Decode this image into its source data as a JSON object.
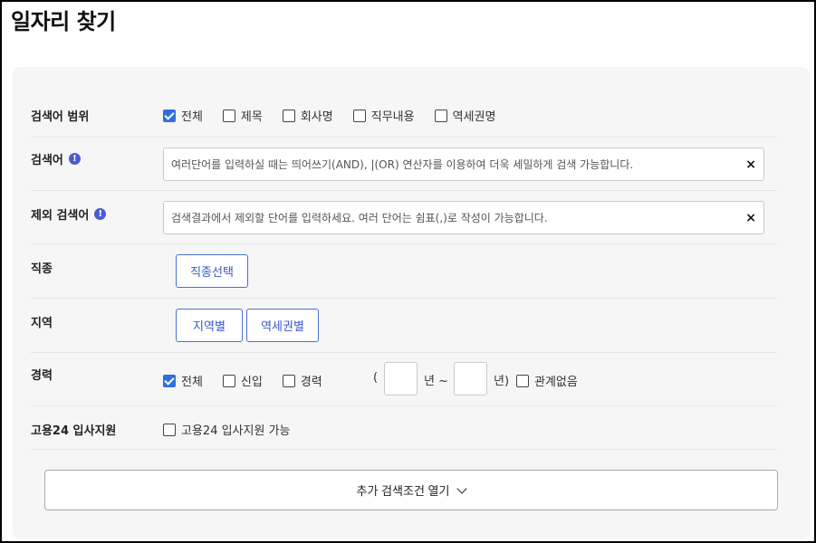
{
  "page": {
    "title": "일자리 찾기"
  },
  "search_scope": {
    "label": "검색어 범위",
    "options": [
      {
        "label": "전체",
        "checked": true
      },
      {
        "label": "제목",
        "checked": false
      },
      {
        "label": "회사명",
        "checked": false
      },
      {
        "label": "직무내용",
        "checked": false
      },
      {
        "label": "역세권명",
        "checked": false
      }
    ]
  },
  "keyword": {
    "label": "검색어",
    "info_icon": "!",
    "placeholder": "여러단어를 입력하실 때는 띄어쓰기(AND), |(OR) 연산자를 이용하여 더욱 세밀하게 검색 가능합니다.",
    "clear_icon": "×"
  },
  "exclude_keyword": {
    "label": "제외 검색어",
    "info_icon": "!",
    "placeholder": "검색결과에서 제외할 단어를 입력하세요. 여러 단어는 쉼표(,)로 작성이 가능합니다.",
    "clear_icon": "×"
  },
  "job_type": {
    "label": "직종",
    "button": "직종선택"
  },
  "region": {
    "label": "지역",
    "buttons": [
      "지역별",
      "역세권별"
    ]
  },
  "career": {
    "label": "경력",
    "options": [
      {
        "label": "전체",
        "checked": true
      },
      {
        "label": "신입",
        "checked": false
      },
      {
        "label": "경력",
        "checked": false
      }
    ],
    "open_paren": "(",
    "year_label_1": "년 ~",
    "year_label_2": "년)",
    "no_matter": {
      "label": "관계없음",
      "checked": false
    }
  },
  "goyong24": {
    "label": "고용24 입사지원",
    "option": {
      "label": "고용24 입사지원 가능",
      "checked": false
    }
  },
  "more_conditions": {
    "label": "추가 검색조건 열기",
    "icon": "chevron-down"
  },
  "colors": {
    "accent": "#2f6fde",
    "button_border": "#4a6fd6",
    "panel_bg": "#f6f6f7"
  }
}
